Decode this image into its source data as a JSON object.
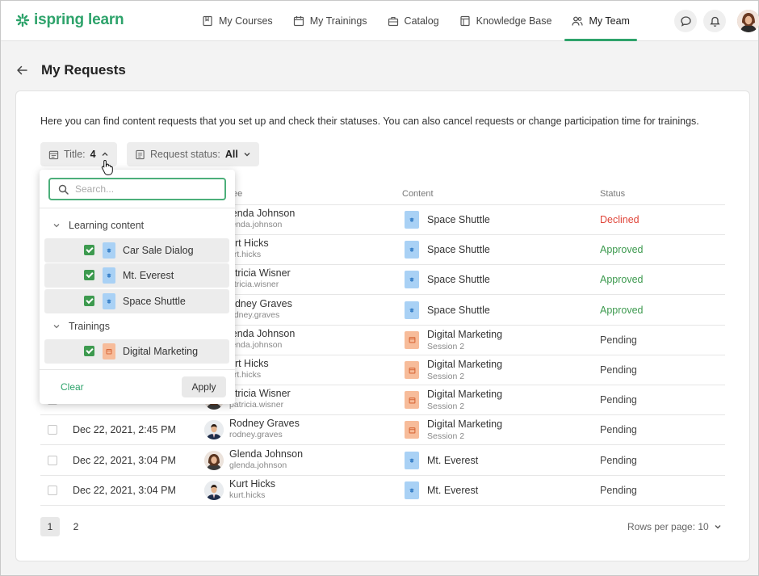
{
  "brand": {
    "name": "ispring learn",
    "color": "#2ea36b"
  },
  "nav": [
    {
      "label": "My Courses",
      "icon": "courses-icon"
    },
    {
      "label": "My Trainings",
      "icon": "calendar-icon"
    },
    {
      "label": "Catalog",
      "icon": "catalog-icon"
    },
    {
      "label": "Knowledge Base",
      "icon": "book-icon"
    },
    {
      "label": "My Team",
      "icon": "team-icon",
      "active": true
    }
  ],
  "page": {
    "title": "My Requests",
    "intro": "Here you can find content requests that you set up and check their statuses. You can also cancel requests or change participation time for trainings."
  },
  "filters": {
    "title": {
      "label": "Title:",
      "value": "4"
    },
    "status": {
      "label": "Request status:",
      "value": "All"
    }
  },
  "table": {
    "headers": {
      "user": "ee",
      "content": "Content",
      "status": "Status"
    },
    "rows": [
      {
        "date": "",
        "name": "lenda Johnson",
        "login": "lenda.johnson",
        "type": "course",
        "content": "Space Shuttle",
        "sub": "",
        "status": "Declined",
        "status_class": "st-declined",
        "gender": "f"
      },
      {
        "date": "",
        "name": "urt Hicks",
        "login": "urt.hicks",
        "type": "course",
        "content": "Space Shuttle",
        "sub": "",
        "status": "Approved",
        "status_class": "st-approved",
        "gender": "m"
      },
      {
        "date": "",
        "name": "atricia Wisner",
        "login": "atricia.wisner",
        "type": "course",
        "content": "Space Shuttle",
        "sub": "",
        "status": "Approved",
        "status_class": "st-approved",
        "gender": "f"
      },
      {
        "date": "",
        "name": "odney Graves",
        "login": "odney.graves",
        "type": "course",
        "content": "Space Shuttle",
        "sub": "",
        "status": "Approved",
        "status_class": "st-approved",
        "gender": "m"
      },
      {
        "date": "",
        "name": "lenda Johnson",
        "login": "lenda.johnson",
        "type": "training",
        "content": "Digital Marketing",
        "sub": "Session 2",
        "status": "Pending",
        "status_class": "st-pending",
        "gender": "f"
      },
      {
        "date": "",
        "name": "urt Hicks",
        "login": "urt.hicks",
        "type": "training",
        "content": "Digital Marketing",
        "sub": "Session 2",
        "status": "Pending",
        "status_class": "st-pending",
        "gender": "m"
      },
      {
        "date": "",
        "name": "atricia Wisner",
        "login": "patricia.wisner",
        "type": "training",
        "content": "Digital Marketing",
        "sub": "Session 2",
        "status": "Pending",
        "status_class": "st-pending",
        "gender": "f"
      },
      {
        "date": "Dec 22, 2021, 2:45 PM",
        "name": "Rodney Graves",
        "login": "rodney.graves",
        "type": "training",
        "content": "Digital Marketing",
        "sub": "Session 2",
        "status": "Pending",
        "status_class": "st-pending",
        "gender": "m"
      },
      {
        "date": "Dec 22, 2021, 3:04 PM",
        "name": "Glenda Johnson",
        "login": "glenda.johnson",
        "type": "course",
        "content": "Mt. Everest",
        "sub": "",
        "status": "Pending",
        "status_class": "st-pending",
        "gender": "f"
      },
      {
        "date": "Dec 22, 2021, 3:04 PM",
        "name": "Kurt Hicks",
        "login": "kurt.hicks",
        "type": "course",
        "content": "Mt. Everest",
        "sub": "",
        "status": "Pending",
        "status_class": "st-pending",
        "gender": "m"
      }
    ]
  },
  "pagination": {
    "pages": [
      "1",
      "2"
    ],
    "rows_per_page": "Rows per page: 10"
  },
  "dropdown": {
    "search_placeholder": "Search...",
    "groups": [
      {
        "label": "Learning content",
        "items": [
          {
            "label": "Car Sale Dialog",
            "type": "course",
            "checked": true
          },
          {
            "label": "Mt. Everest",
            "type": "course",
            "checked": true
          },
          {
            "label": "Space Shuttle",
            "type": "course",
            "checked": true
          }
        ]
      },
      {
        "label": "Trainings",
        "items": [
          {
            "label": "Digital Marketing",
            "type": "training",
            "checked": true
          }
        ]
      }
    ],
    "clear_label": "Clear",
    "apply_label": "Apply"
  }
}
